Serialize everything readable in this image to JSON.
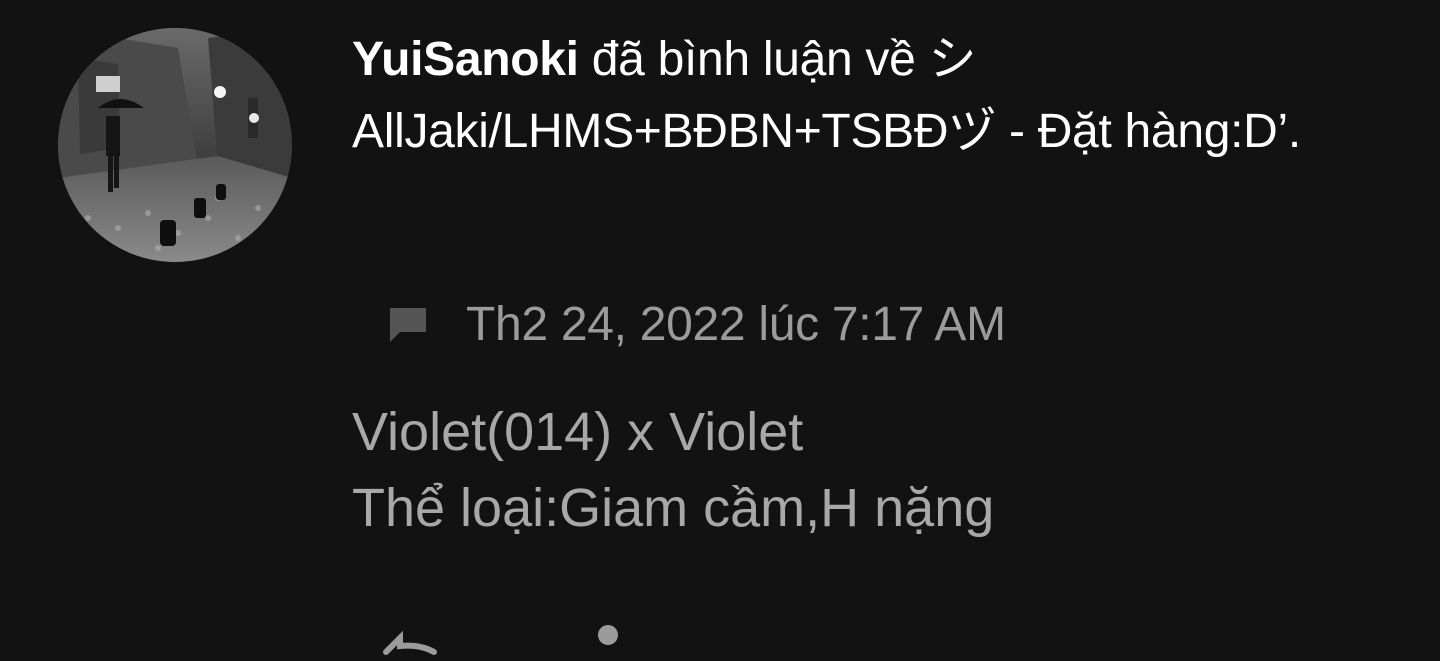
{
  "notification": {
    "username": "YuiSanoki",
    "action_text": " đã bình luận về シAllJaki/LHMS+BĐBN+TSBĐヅ - Đặt hàng:D’.",
    "timestamp": "Th2 24, 2022 lúc 7:17 AM",
    "comment_lines": [
      "Violet(014) x Violet",
      "Thể loại:Giam cầm,H nặng"
    ],
    "icons": {
      "comment": "comment-icon",
      "reply": "reply-icon",
      "more": "more-icon"
    },
    "colors": {
      "background": "#121212",
      "headline": "#ffffff",
      "timestamp": "#9b9b9b",
      "comment": "#a8a8a8"
    }
  }
}
